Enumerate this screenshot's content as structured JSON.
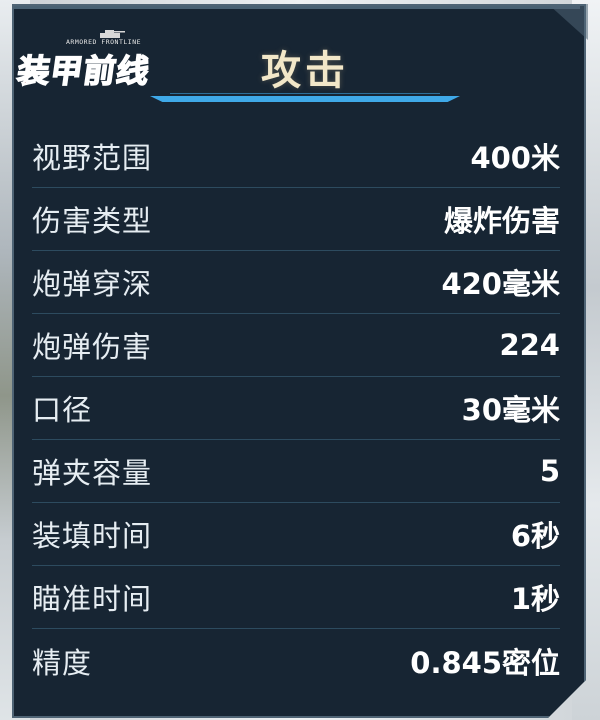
{
  "logo": {
    "subtitle": "ARMORED FRONTLINE",
    "name": "装甲前线"
  },
  "panel": {
    "title": "攻击"
  },
  "stats": [
    {
      "label": "视野范围",
      "value": "400米"
    },
    {
      "label": "伤害类型",
      "value": "爆炸伤害"
    },
    {
      "label": "炮弹穿深",
      "value": "420毫米"
    },
    {
      "label": "炮弹伤害",
      "value": "224"
    },
    {
      "label": "口径",
      "value": "30毫米"
    },
    {
      "label": "弹夹容量",
      "value": "5"
    },
    {
      "label": "装填时间",
      "value": "6秒"
    },
    {
      "label": "瞄准时间",
      "value": "1秒"
    },
    {
      "label": "精度",
      "value": "0.845密位"
    }
  ],
  "colors": {
    "panel_bg": "#172533",
    "title_text": "#f2e7c8",
    "accent_bar": "#3fa9e8",
    "row_divider": "#2d4b5f",
    "logo_red": "#8f1f1a"
  }
}
